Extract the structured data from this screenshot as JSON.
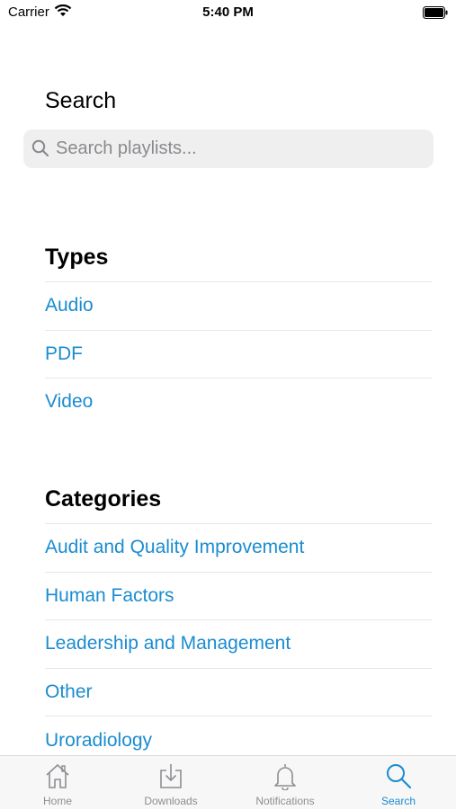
{
  "status": {
    "carrier": "Carrier",
    "time": "5:40 PM"
  },
  "search": {
    "title": "Search",
    "placeholder": "Search playlists..."
  },
  "types": {
    "title": "Types",
    "items": [
      "Audio",
      "PDF",
      "Video"
    ]
  },
  "categories": {
    "title": "Categories",
    "items": [
      "Audit and Quality Improvement",
      "Human Factors",
      "Leadership and Management",
      "Other",
      "Uroradiology"
    ]
  },
  "tabs": [
    {
      "label": "Home",
      "icon": "home-icon"
    },
    {
      "label": "Downloads",
      "icon": "download-icon"
    },
    {
      "label": "Notifications",
      "icon": "bell-icon"
    },
    {
      "label": "Search",
      "icon": "search-icon",
      "active": true
    }
  ],
  "colors": {
    "accent": "#1a8cd0",
    "inactive": "#8e8e93"
  }
}
